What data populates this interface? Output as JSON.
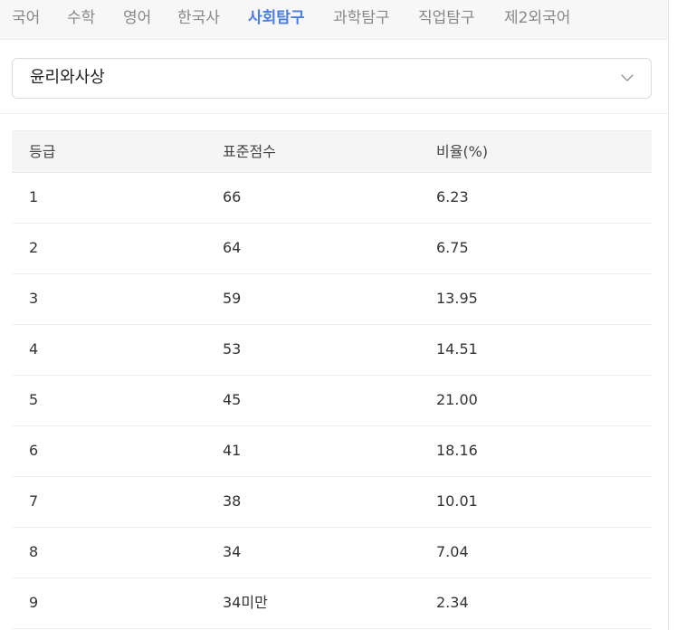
{
  "tabs": [
    {
      "label": "국어",
      "active": false
    },
    {
      "label": "수학",
      "active": false
    },
    {
      "label": "영어",
      "active": false
    },
    {
      "label": "한국사",
      "active": false
    },
    {
      "label": "사회탐구",
      "active": true
    },
    {
      "label": "과학탐구",
      "active": false
    },
    {
      "label": "직업탐구",
      "active": false
    },
    {
      "label": "제2외국어",
      "active": false
    }
  ],
  "colors": {
    "active_tab": "#4a7fe0",
    "inactive_tab": "#888888",
    "header_bg": "#f5f5f6"
  },
  "subject_select": {
    "value": "윤리와사상",
    "icon": "chevron-down-icon"
  },
  "table": {
    "headers": [
      "등급",
      "표준점수",
      "비율(%)"
    ],
    "rows": [
      [
        "1",
        "66",
        "6.23"
      ],
      [
        "2",
        "64",
        "6.75"
      ],
      [
        "3",
        "59",
        "13.95"
      ],
      [
        "4",
        "53",
        "14.51"
      ],
      [
        "5",
        "45",
        "21.00"
      ],
      [
        "6",
        "41",
        "18.16"
      ],
      [
        "7",
        "38",
        "10.01"
      ],
      [
        "8",
        "34",
        "7.04"
      ],
      [
        "9",
        "34미만",
        "2.34"
      ]
    ]
  }
}
